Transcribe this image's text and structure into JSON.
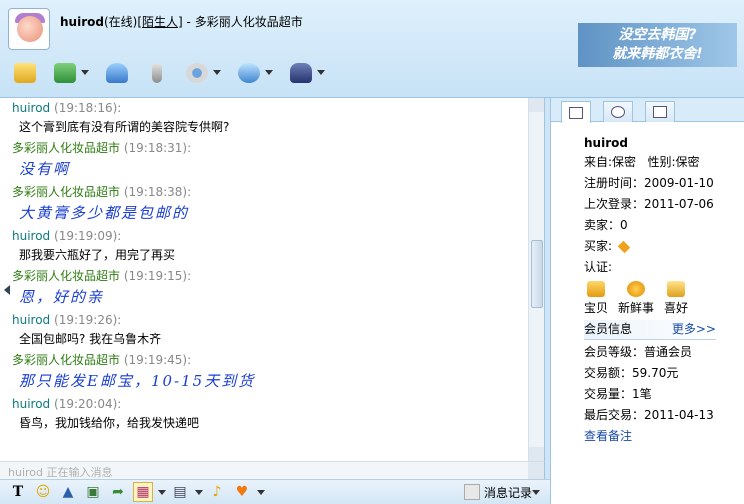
{
  "header": {
    "username": "huirod",
    "online_status": "(在线)",
    "relation_tag": "陌生人",
    "separator": "-",
    "shop_name": "多彩丽人化妆品超市",
    "ad_line1": "没空去韩国?",
    "ad_line2": "就来韩都衣舍!"
  },
  "toolbar": {
    "icons": [
      "message-icon",
      "transfer-icon",
      "add-contact-icon",
      "voice-icon",
      "webcam-icon",
      "remote-assist-icon",
      "security-icon"
    ]
  },
  "messages": [
    {
      "sender": "huirod",
      "time": "(19:18:16):",
      "text": "这个膏到底有没有所谓的美容院专供啊?",
      "role": "buyer"
    },
    {
      "sender": "多彩丽人化妆品超市",
      "time": "(19:18:31):",
      "text": "没有啊",
      "role": "shop"
    },
    {
      "sender": "多彩丽人化妆品超市",
      "time": "(19:18:38):",
      "text": "大黄膏多少都是包邮的",
      "role": "shop"
    },
    {
      "sender": "huirod",
      "time": "(19:19:09):",
      "text": "那我要六瓶好了，用完了再买",
      "role": "buyer"
    },
    {
      "sender": "多彩丽人化妆品超市",
      "time": "(19:19:15):",
      "text": "恩，好的亲",
      "role": "shop"
    },
    {
      "sender": "huirod",
      "time": "(19:19:26):",
      "text": "全国包邮吗? 我在乌鲁木齐",
      "role": "buyer"
    },
    {
      "sender": "多彩丽人化妆品超市",
      "time": "(19:19:45):",
      "text": "那只能发E邮宝，10-15天到货",
      "role": "shop"
    },
    {
      "sender": "huirod",
      "time": "(19:20:04):",
      "text": "昏鸟，我加钱给你，给我发快递吧",
      "role": "buyer"
    }
  ],
  "status_line": {
    "text": "huirod 正在输入消息"
  },
  "input_toolbar": {
    "history_label": "消息记录"
  },
  "profile": {
    "name": "huirod",
    "from": "来自:保密",
    "gender": "性别:保密",
    "register": "注册时间：2009-01-10",
    "last_login": "上次登录：2011-07-06",
    "seller": "卖家：0",
    "buyer": "买家:",
    "certification": "认证:",
    "shortcuts": [
      "宝贝",
      "新鲜事",
      "喜好"
    ],
    "member_section_title": "会员信息",
    "more_link": "更多>>",
    "member_level": "会员等级：普通会员",
    "trade_amount": "交易额：59.70元",
    "trade_count": "交易量：1笔",
    "last_trade": "最后交易：2011-04-13",
    "view_notes": "查看备注"
  },
  "colors": {
    "buyer_name": "#0a7a80",
    "shop_name": "#2e7d12",
    "handwriting": "#1a3fd0",
    "link": "#1a4ba8"
  }
}
